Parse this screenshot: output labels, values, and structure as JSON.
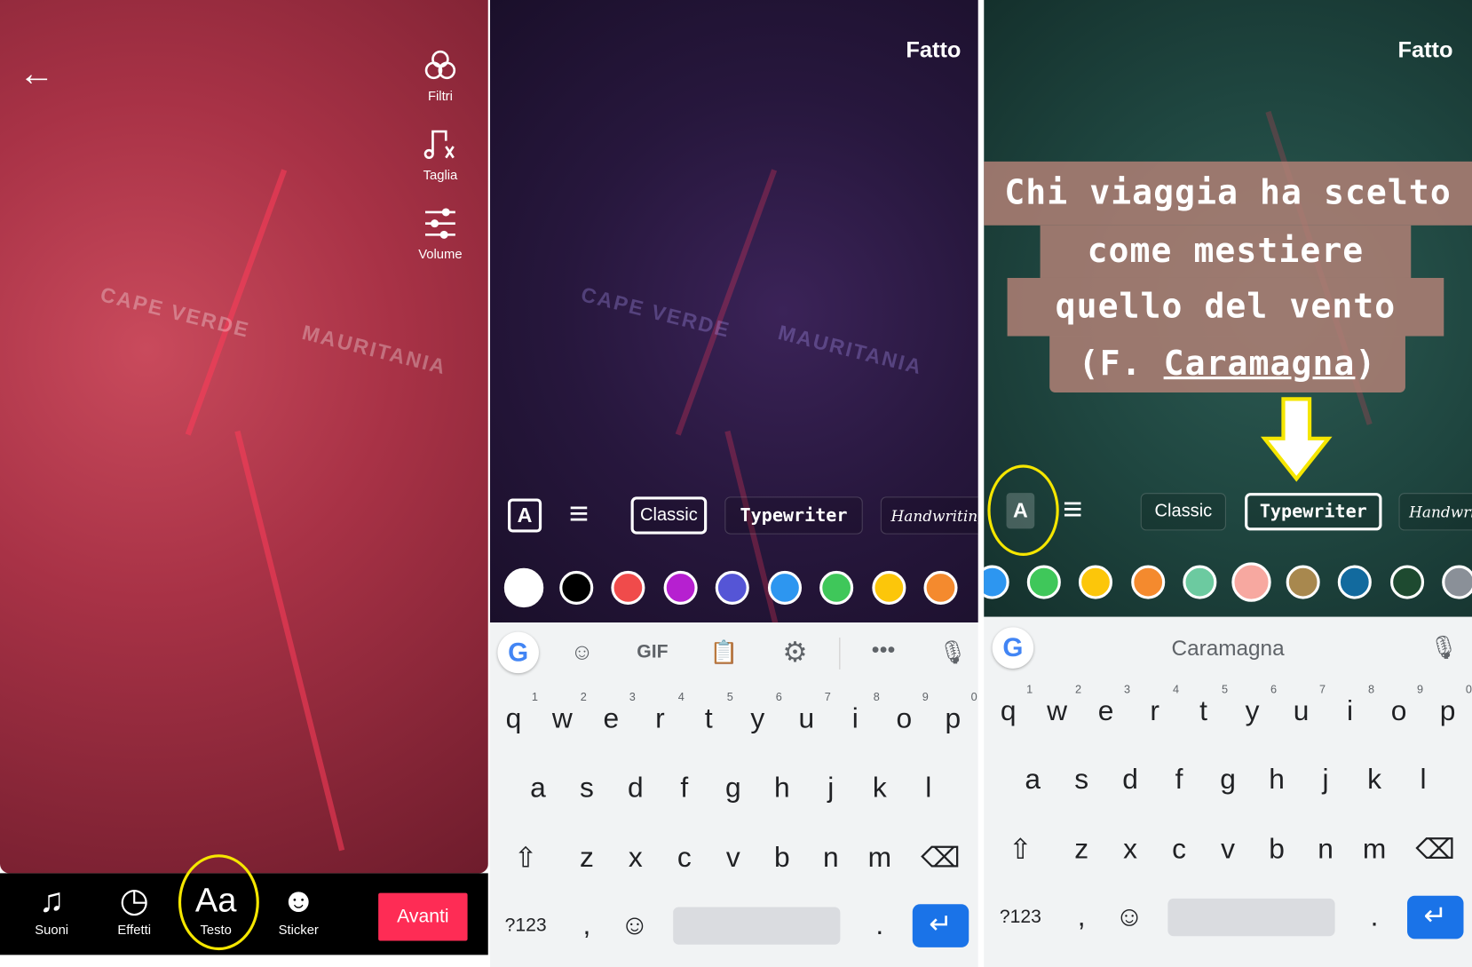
{
  "panel1": {
    "map_labels": [
      "CAPE VERDE",
      "MAURITANIA"
    ],
    "back_icon": "arrow-left",
    "side_tools": [
      {
        "label": "Filtri",
        "icon": "filters"
      },
      {
        "label": "Taglia",
        "icon": "music-scissors"
      },
      {
        "label": "Volume",
        "icon": "sliders"
      }
    ],
    "bottom_nav": [
      {
        "label": "Suoni",
        "icon": "music-check"
      },
      {
        "label": "Effetti",
        "icon": "timer"
      },
      {
        "label": "Testo",
        "icon": "Aa"
      },
      {
        "label": "Sticker",
        "icon": "sticker"
      }
    ],
    "next_button": "Avanti",
    "highlight": "Testo",
    "accent": "#fe2c55"
  },
  "panel2": {
    "done": "Fatto",
    "map_labels": [
      "CAPE VERDE",
      "MAURITANIA"
    ],
    "fonts": [
      "Classic",
      "Typewriter",
      "Handwriting"
    ],
    "selected_font": "Classic",
    "colors": [
      "#ffffff",
      "#000000",
      "#f04b4b",
      "#b620d0",
      "#5555d6",
      "#2d96f0",
      "#3fc75a",
      "#fcc60a",
      "#f48a2e"
    ],
    "keyboard_toolbar": {
      "gif": "GIF",
      "icons": [
        "google",
        "sticker",
        "gif",
        "clipboard",
        "settings",
        "more",
        "mic"
      ]
    },
    "keyboard": {
      "row1": [
        [
          "q",
          "1"
        ],
        [
          "w",
          "2"
        ],
        [
          "e",
          "3"
        ],
        [
          "r",
          "4"
        ],
        [
          "t",
          "5"
        ],
        [
          "y",
          "6"
        ],
        [
          "u",
          "7"
        ],
        [
          "i",
          "8"
        ],
        [
          "o",
          "9"
        ],
        [
          "p",
          "0"
        ]
      ],
      "row2": [
        "a",
        "s",
        "d",
        "f",
        "g",
        "h",
        "j",
        "k",
        "l"
      ],
      "row3": [
        "z",
        "x",
        "c",
        "v",
        "b",
        "n",
        "m"
      ],
      "sym": "?123",
      "comma": ",",
      "period": ".",
      "enter": "↵",
      "shift": "⇧",
      "backspace": "⌫",
      "emoji": "☺"
    }
  },
  "panel3": {
    "done": "Fatto",
    "text_lines": [
      "Chi viaggia ha scelto",
      "come mestiere",
      "quello del vento",
      "(F. ",
      "Caramagna",
      ")"
    ],
    "fonts": [
      "Classic",
      "Typewriter",
      "Handwriting"
    ],
    "selected_font": "Typewriter",
    "colors": [
      "#2d96f0",
      "#3fc75a",
      "#fcc60a",
      "#f48a2e",
      "#6ccaa0",
      "#f7a8a0",
      "#a8884e",
      "#126a9e",
      "#1e4a30",
      "#8a9098"
    ],
    "suggestion": "Caramagna",
    "highlight_color": "#f5e600"
  }
}
